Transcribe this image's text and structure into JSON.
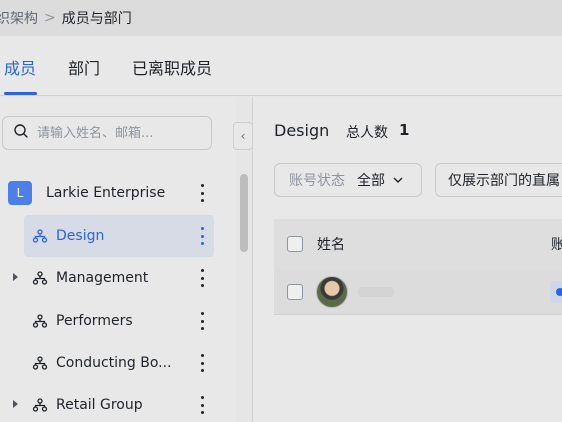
{
  "breadcrumb": {
    "parent": "织架构",
    "separator": ">",
    "current": "成员与部门"
  },
  "tabs": [
    {
      "label": "成员",
      "active": true
    },
    {
      "label": "部门",
      "active": false
    },
    {
      "label": "已离职成员",
      "active": false
    }
  ],
  "search": {
    "placeholder": "请输入姓名、邮箱..."
  },
  "tree": [
    {
      "label": "Larkie Enterprise",
      "badge": "L",
      "type": "enterprise",
      "expandable": false,
      "active": false
    },
    {
      "label": "Design",
      "type": "dept",
      "expandable": false,
      "active": true
    },
    {
      "label": "Management",
      "type": "dept",
      "expandable": true,
      "active": false
    },
    {
      "label": "Performers",
      "type": "dept",
      "expandable": false,
      "active": false
    },
    {
      "label": "Conducting Bo...",
      "type": "dept",
      "expandable": false,
      "active": false
    },
    {
      "label": "Retail Group",
      "type": "dept",
      "expandable": true,
      "active": false
    }
  ],
  "collapse_icon": "chevron-left-icon",
  "detail": {
    "title": "Design",
    "total_label": "总人数",
    "total_count": "1",
    "filter_label": "账号状态",
    "filter_value": "全部",
    "filter2_label": "仅展示部门的直属",
    "table": {
      "col_name": "姓名",
      "col_account": "账"
    }
  },
  "colors": {
    "accent": "#2c63e6",
    "badge": "#4d7fe8"
  }
}
